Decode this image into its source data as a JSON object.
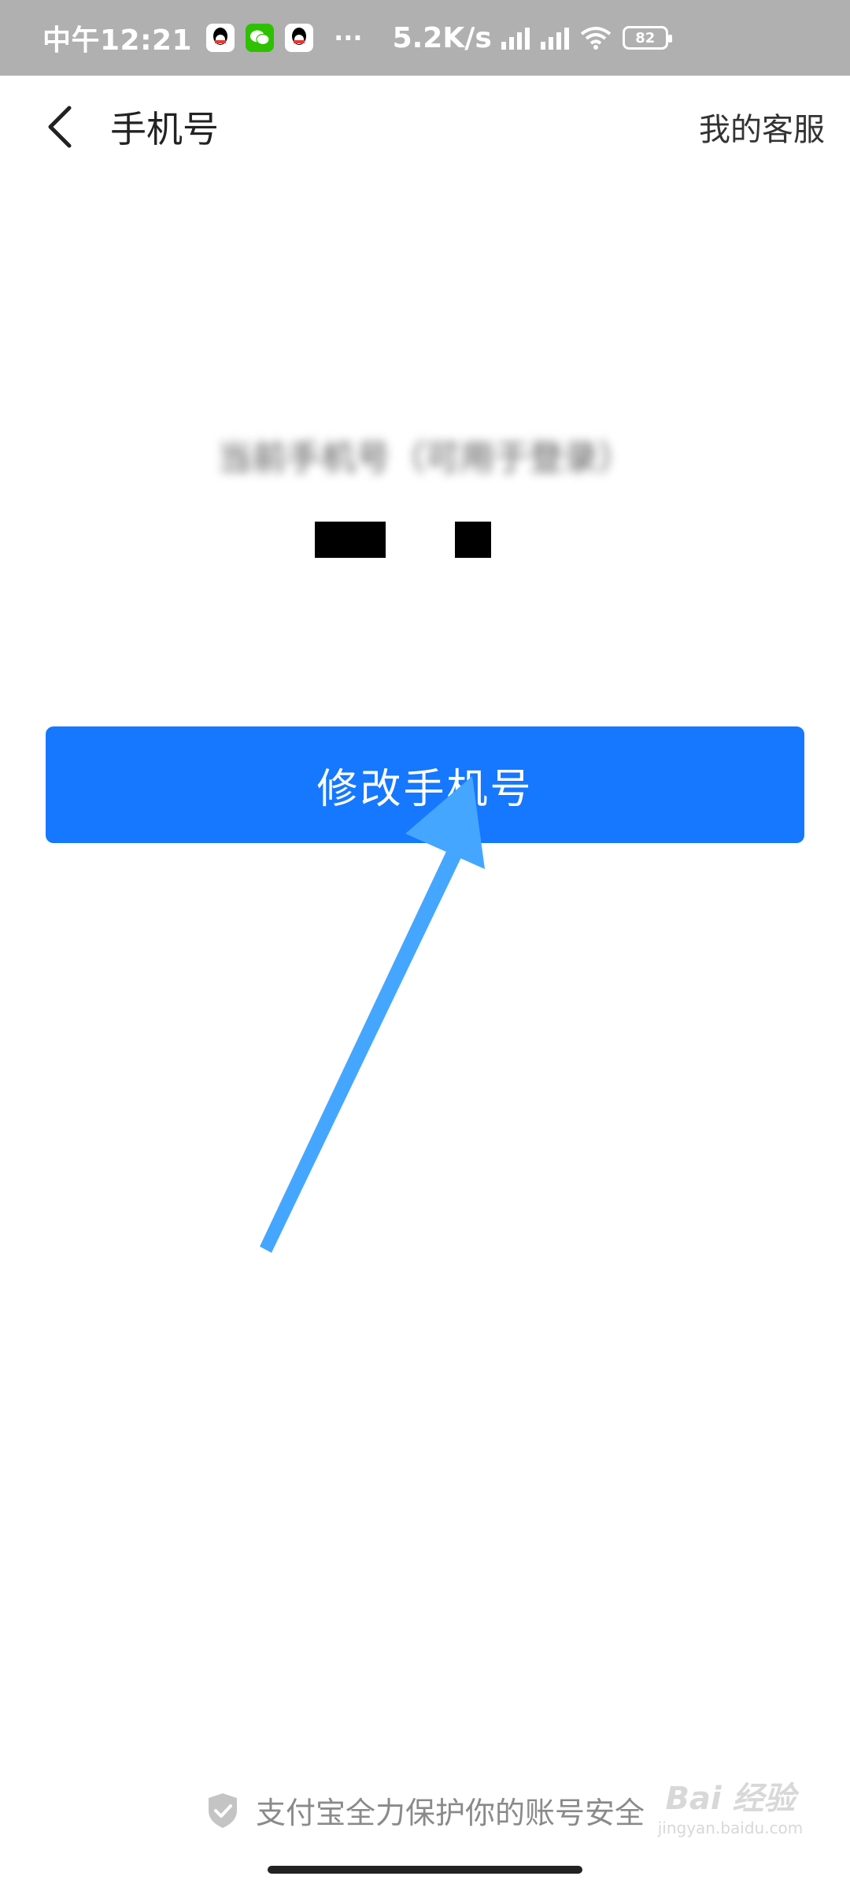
{
  "status_bar": {
    "time": "中午12:21",
    "more": "···",
    "network_speed": "5.2K/s",
    "battery_level": "82",
    "icons": [
      "qq-icon",
      "wechat-icon",
      "qq-icon",
      "signal-icon",
      "signal-icon",
      "wifi-icon",
      "battery-icon"
    ]
  },
  "nav": {
    "back_icon": "chevron-left-icon",
    "title": "手机号",
    "service_label": "我的客服"
  },
  "content": {
    "phone_label": "当前手机号（可用于登录）",
    "phone_value_masked": true,
    "change_button_label": "修改手机号"
  },
  "footer": {
    "icon": "shield-check-icon",
    "text": "支付宝全力保护你的账号安全"
  },
  "watermark": {
    "text": "Bai 经验",
    "sub": "jingyan.baidu.com"
  },
  "colors": {
    "primary": "#1677ff",
    "annotation_arrow": "#45a6ff",
    "status_bar_bg": "#b0b0b0"
  }
}
